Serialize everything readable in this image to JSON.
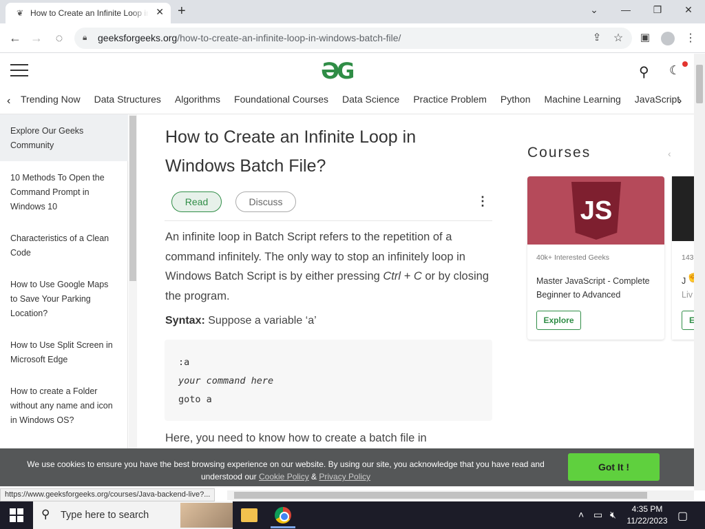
{
  "browser": {
    "tab_title": "How to Create an Infinite Loop in Windows Batch File?",
    "tab_favicon": "gfg-favicon",
    "new_tab": "+",
    "url_domain": "geeksforgeeks.org",
    "url_path": "/how-to-create-an-infinite-loop-in-windows-batch-file/",
    "status_url": "https://www.geeksforgeeks.org/courses/Java-backend-live?..."
  },
  "header": {
    "logo": "ƏG"
  },
  "nav": {
    "items": [
      "Trending Now",
      "Data Structures",
      "Algorithms",
      "Foundational Courses",
      "Data Science",
      "Practice Problem",
      "Python",
      "Machine Learning",
      "JavaScript"
    ]
  },
  "sidebar": {
    "items": [
      "Explore Our Geeks Community",
      "10 Methods To Open the Command Prompt in Windows 10",
      "Characteristics of a Clean Code",
      "How to Use Google Maps to Save Your Parking Location?",
      "How to Use Split Screen in Microsoft Edge",
      "How to create a Folder without any name and icon in Windows OS?"
    ]
  },
  "article": {
    "title": "How to Create an Infinite Loop in Windows Batch File?",
    "read_label": "Read",
    "discuss_label": "Discuss",
    "para1_a": "An infinite loop in Batch Script refers to the repetition of a command infinitely. The only way to stop an infinitely loop in Windows Batch Script is by either pressing ",
    "para1_em": "Ctrl + C",
    "para1_b": " or by closing the program.",
    "syntax_label": "Syntax:",
    "syntax_text": " Suppose a variable ‘a’",
    "code_line1": ":a",
    "code_line2": "your command here",
    "code_line3": "goto a",
    "para2": "Here, you need to know how to create a batch file in"
  },
  "courses": {
    "title": "Courses",
    "card1": {
      "logo_text": "JS",
      "meta": "40k+ Interested Geeks",
      "title": "Master JavaScript - Complete Beginner to Advanced",
      "button": "Explore"
    },
    "card2": {
      "meta": "143",
      "title_a": "J",
      "title_b": "Liv",
      "button": "E"
    }
  },
  "cookie": {
    "text_before": "We use cookies to ensure you have the best browsing experience on our website. By using our site, you acknowledge that you have read and understood our ",
    "cookie_policy": "Cookie Policy",
    "amp": " & ",
    "privacy_policy": "Privacy Policy",
    "button": "Got It !"
  },
  "taskbar": {
    "search_placeholder": "Type here to search",
    "time": "4:35 PM",
    "date": "11/22/2023"
  },
  "colors": {
    "brand_green": "#2f8d46",
    "cookie_button": "#5fd03e",
    "cookie_banner": "#555758"
  }
}
